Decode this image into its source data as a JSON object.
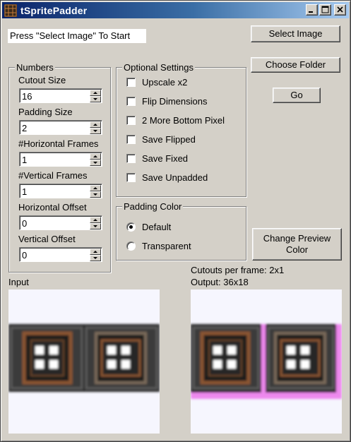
{
  "window": {
    "title": "tSpritePadder",
    "minimize_glyph": "_",
    "maximize_glyph": "□",
    "close_glyph": "×"
  },
  "status": "Press \"Select Image\" To Start",
  "buttons": {
    "select_image": "Select Image",
    "choose_folder": "Choose Folder",
    "go": "Go",
    "change_preview_color_line1": "Change Preview",
    "change_preview_color_line2": "Color"
  },
  "numbers": {
    "legend": "Numbers",
    "fields": [
      {
        "label": "Cutout Size",
        "value": "16"
      },
      {
        "label": "Padding Size",
        "value": "2"
      },
      {
        "label": "#Horizontal Frames",
        "value": "1"
      },
      {
        "label": "#Vertical Frames",
        "value": "1"
      },
      {
        "label": "Horizontal Offset",
        "value": "0"
      },
      {
        "label": "Vertical Offset",
        "value": "0"
      }
    ]
  },
  "optional": {
    "legend": "Optional Settings",
    "options": [
      {
        "label": "Upscale x2",
        "checked": false
      },
      {
        "label": "Flip Dimensions",
        "checked": false
      },
      {
        "label": "2 More Bottom Pixel",
        "checked": false
      },
      {
        "label": "Save Flipped",
        "checked": false
      },
      {
        "label": "Save Fixed",
        "checked": false
      },
      {
        "label": "Save Unpadded",
        "checked": false
      }
    ]
  },
  "padding_color": {
    "legend": "Padding Color",
    "options": [
      {
        "label": "Default",
        "selected": true
      },
      {
        "label": "Transparent",
        "selected": false
      }
    ]
  },
  "info": {
    "cutouts_per_frame": "Cutouts per frame: 2x1",
    "output": "Output: 36x18"
  },
  "input_label": "Input",
  "colors": {
    "preview_bg": "#f6f6fe",
    "padding_magenta": "#ee88ee",
    "tile_dark": "#2a2a2a",
    "tile_frame": "#8a5530",
    "title_blue": "#0a246a"
  }
}
